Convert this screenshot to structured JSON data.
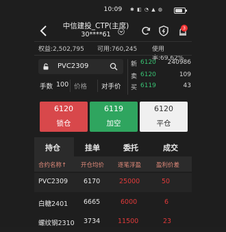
{
  "status": {
    "time": "10:09",
    "icons_text": "✱ ◧ ◔ ▲ ◍"
  },
  "header": {
    "title_line1": "中信建投_CTP(主席)",
    "title_line2": "30****61",
    "badge": "3"
  },
  "account": {
    "equity": "权益:2,502,795",
    "available": "可用:760,245",
    "usage": "使用率:69.62%"
  },
  "trade": {
    "symbol": "PVC2309",
    "qty_label": "手数",
    "qty_value": "100",
    "price_label": "价格",
    "counter_label": "对手价"
  },
  "quotes": {
    "rows": [
      {
        "label": "新",
        "price": "6120",
        "value": "240986"
      },
      {
        "label": "卖",
        "price": "6120",
        "value": "109"
      },
      {
        "label": "买",
        "price": "6119",
        "value": "43"
      }
    ]
  },
  "actions": {
    "lock_price": "6120",
    "lock_label": "锁仓",
    "short_price": "6119",
    "short_label": "加空",
    "close_price": "6120",
    "close_label": "平仓"
  },
  "tabs": [
    "持仓",
    "挂单",
    "委托",
    "成交"
  ],
  "table": {
    "headers": [
      "合约名称↑",
      "开仓均价",
      "逐笔浮盈",
      "盈利价差"
    ],
    "rows": [
      {
        "name": "PVC2309",
        "avg": "6170",
        "pnl": "25000",
        "spread": "50"
      },
      {
        "name": "白糖2401",
        "avg": "6665",
        "pnl": "6000",
        "spread": "6"
      },
      {
        "name": "螺纹钢2310",
        "avg": "3734",
        "pnl": "11500",
        "spread": "23"
      }
    ]
  },
  "colors": {
    "green": "#38c172",
    "red": "#e03a3a",
    "lock_btn": "#d8484b",
    "short_btn": "#2fa55f",
    "close_btn": "#f0f0f0"
  }
}
